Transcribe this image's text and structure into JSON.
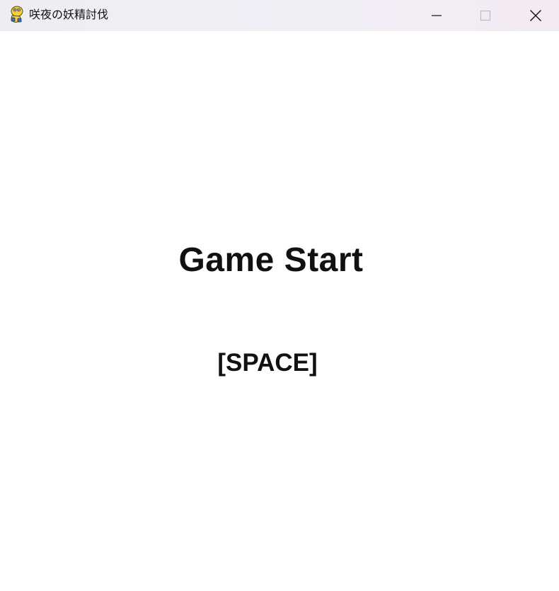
{
  "window": {
    "title": "咲夜の妖精討伐",
    "app_icon": "python-snake-icon",
    "controls": {
      "minimize_icon": "minimize-icon",
      "maximize_icon": "maximize-icon",
      "close_icon": "close-icon"
    }
  },
  "screen": {
    "title": "Game Start",
    "prompt": "[SPACE]"
  },
  "colors": {
    "background": "#ffffff",
    "text": "#111111",
    "titlebar": "#efedf4",
    "icon_yellow": "#f7d23a",
    "icon_blue": "#3a6fb0"
  }
}
